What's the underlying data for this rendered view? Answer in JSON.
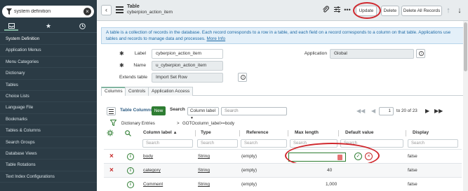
{
  "navigator": {
    "search_value": "system definition",
    "tabs": [
      {
        "name": "all-apps",
        "icon": "inbox-icon"
      },
      {
        "name": "favorites",
        "icon": "star-icon"
      },
      {
        "name": "history",
        "icon": "clock-icon"
      }
    ],
    "items": [
      "System Definition",
      "Application Menus",
      "Menu Categories",
      "Dictionary",
      "Tables",
      "Choice Lists",
      "Language File",
      "Bookmarks",
      "Tables & Columns",
      "Search Groups",
      "Database Views",
      "Table Rotations",
      "Text Index Configurations"
    ]
  },
  "header": {
    "title": "Table",
    "subtitle": "cyberpion_action_item",
    "buttons": {
      "update": "Update",
      "delete": "Delete",
      "delete_all_records": "Delete All Records"
    }
  },
  "info_message": {
    "text": "A table is a collection of records in the database. Each record corresponds to a row in a table, and each field on a record corresponds to a column on that table. Applications use tables and records to manage data and processes.",
    "link": "More Info"
  },
  "form": {
    "label": {
      "label": "Label",
      "value": "cyberpion_action_item"
    },
    "name": {
      "label": "Name",
      "value": "u_cyberpion_action_item"
    },
    "extends_table": {
      "label": "Extends table",
      "value": "Import Set Row"
    },
    "application": {
      "label": "Application",
      "value": "Global"
    }
  },
  "tabs": [
    "Columns",
    "Controls",
    "Application Access"
  ],
  "list": {
    "title": "Table Columns",
    "new_button": "New",
    "search_label": "Search",
    "search_field": "Column label",
    "search_placeholder": "Search",
    "page_input": "1",
    "page_text": "to 20 of 23",
    "breadcrumb_root": "Dictionary Entries",
    "breadcrumb_filter": "GOTOcolumn_label>=body",
    "columns": [
      "Column label",
      "Type",
      "Reference",
      "Max length",
      "Default value",
      "Display"
    ],
    "filter_placeholder": "Search",
    "rows": [
      {
        "label": "body",
        "type": "String",
        "reference": "(empty)",
        "max_length": "",
        "default": "",
        "display": "false"
      },
      {
        "label": "category",
        "type": "String",
        "reference": "(empty)",
        "max_length": "40",
        "default": "",
        "display": "false"
      },
      {
        "label": "Comment",
        "type": "String",
        "reference": "(empty)",
        "max_length": "1,000",
        "default": "",
        "display": "false"
      }
    ]
  },
  "colors": {
    "nav_bg": "#2b3b45",
    "accent": "#81b5a1",
    "highlight_ring": "#d0282e",
    "new_button": "#2e7d32",
    "info_bg": "#e4f0f9"
  }
}
